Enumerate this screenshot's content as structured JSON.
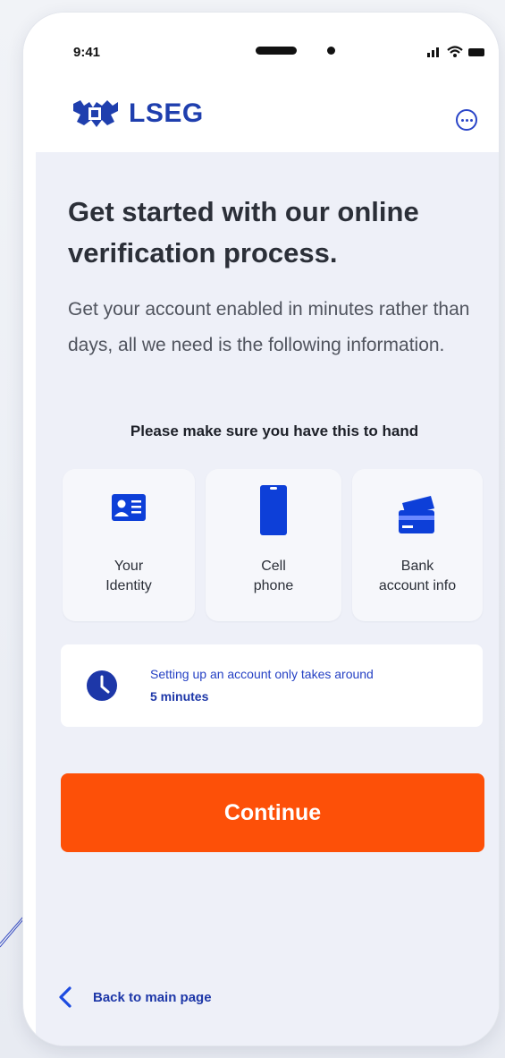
{
  "status_bar": {
    "time": "9:41"
  },
  "brand": {
    "name": "LSEG",
    "color": "#1f3fae"
  },
  "page": {
    "title": "Get started with our online verification process.",
    "intro": "Get your account enabled in minutes rather than days, all we need is the following information.",
    "checklist_hint": "Please make sure you have this to hand"
  },
  "requirements": [
    {
      "icon": "id-card-icon",
      "line1": "Your",
      "line2": "Identity"
    },
    {
      "icon": "cell-phone-icon",
      "line1": "Cell",
      "line2": "phone"
    },
    {
      "icon": "bank-card-icon",
      "line1": "Bank",
      "line2": "account info"
    }
  ],
  "time_notice": {
    "icon": "clock-icon",
    "text": "Setting up an account only takes around",
    "duration": "5 minutes"
  },
  "actions": {
    "continue_label": "Continue",
    "back_label": "Back to main page"
  },
  "colors": {
    "accent_orange": "#fd5008",
    "accent_blue": "#0d3fd8",
    "background": "#eef0f8"
  }
}
